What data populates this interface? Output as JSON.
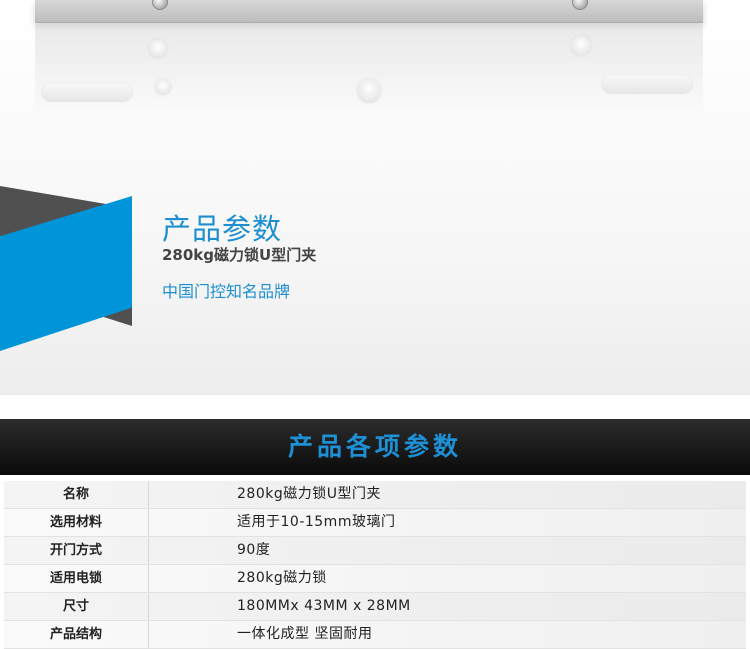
{
  "hero": {
    "title": "产品参数",
    "subtitle": "280kg磁力锁U型门夹",
    "brand": "中国门控知名品牌"
  },
  "section": {
    "title": "产品各项参数"
  },
  "params": [
    {
      "label": "名称",
      "value": "280kg磁力锁U型门夹"
    },
    {
      "label": "选用材料",
      "value": "适用于10-15mm玻璃门"
    },
    {
      "label": "开门方式",
      "value": "90度"
    },
    {
      "label": "适用电锁",
      "value": "280kg磁力锁"
    },
    {
      "label": "尺寸",
      "value": "180MMx 43MM x 28MM"
    },
    {
      "label": "产品结构",
      "value": "一体化成型 坚固耐用"
    }
  ],
  "colors": {
    "accent_blue": "#0095d9",
    "stripe_dark": "#505050",
    "header_bar": "#111111"
  }
}
